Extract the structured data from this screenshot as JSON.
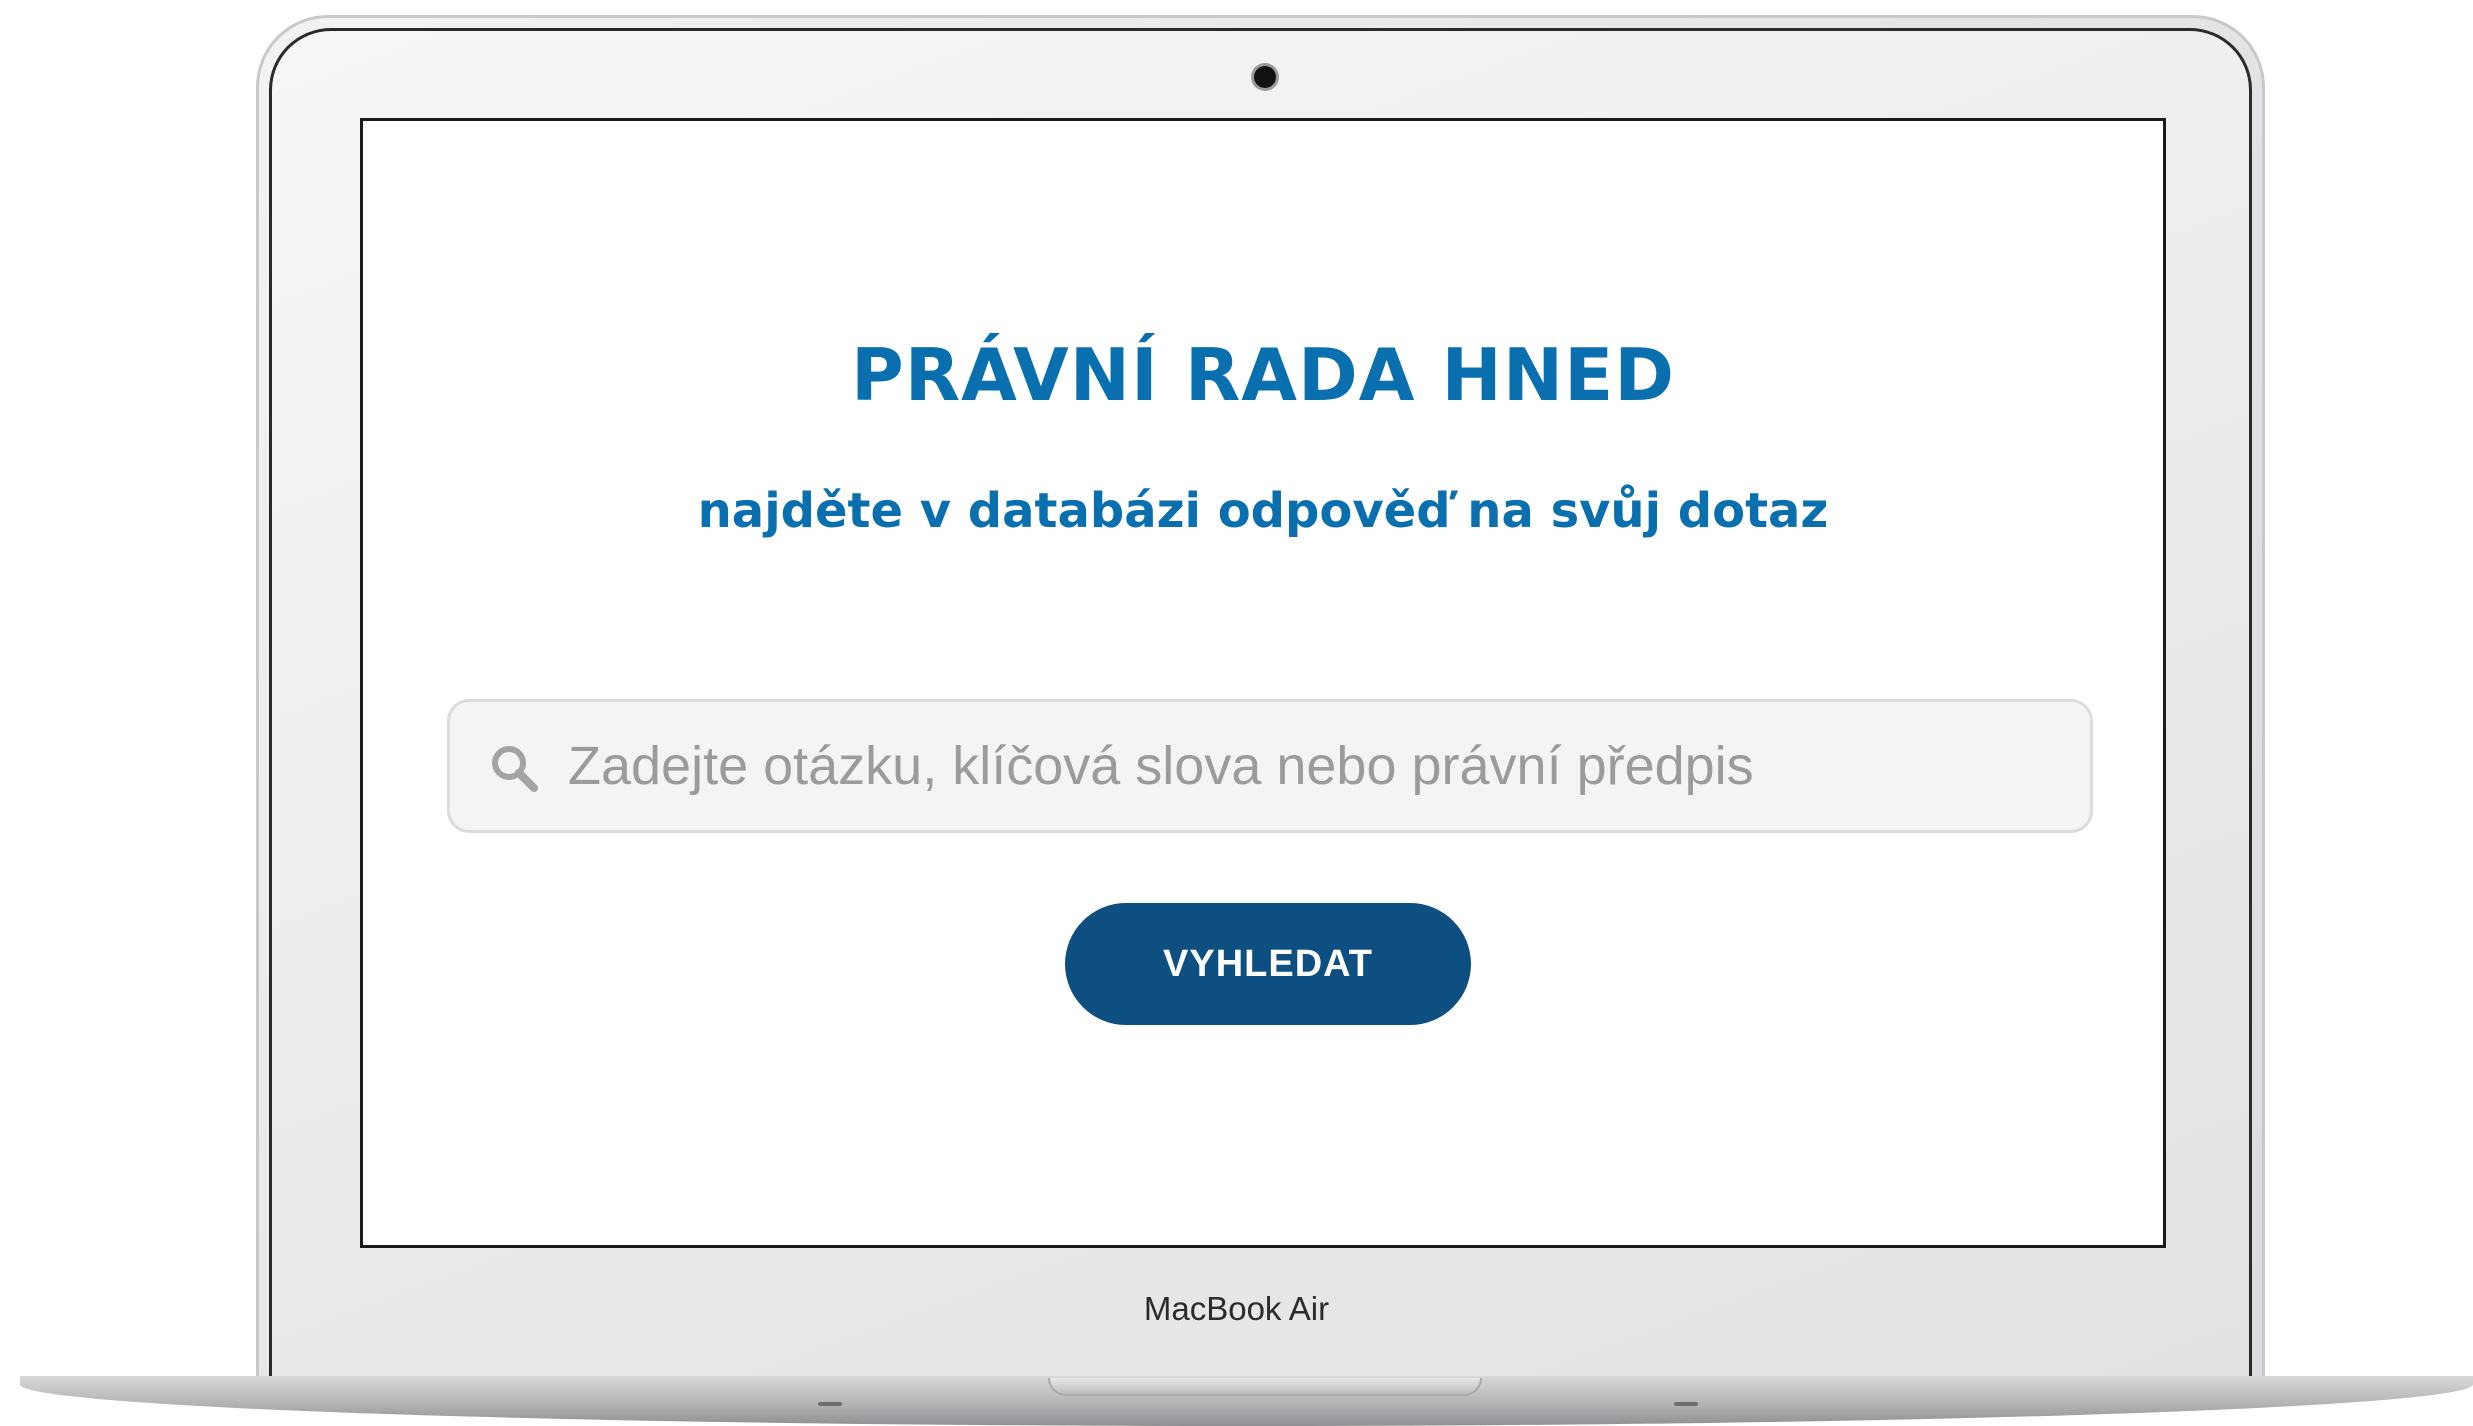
{
  "device": {
    "model_label": "MacBook Air"
  },
  "page": {
    "title": "PRÁVNÍ RADA HNED",
    "subtitle": "najděte v databázi odpověď na svůj dotaz"
  },
  "search": {
    "placeholder": "Zadejte otázku, klíčová slova nebo právní předpis",
    "value": "",
    "icon": "search-icon",
    "button_label": "VYHLEDAT"
  },
  "colors": {
    "title": "#0a6fae",
    "button": "#0d4f80",
    "input_background": "#f4f4f4"
  }
}
